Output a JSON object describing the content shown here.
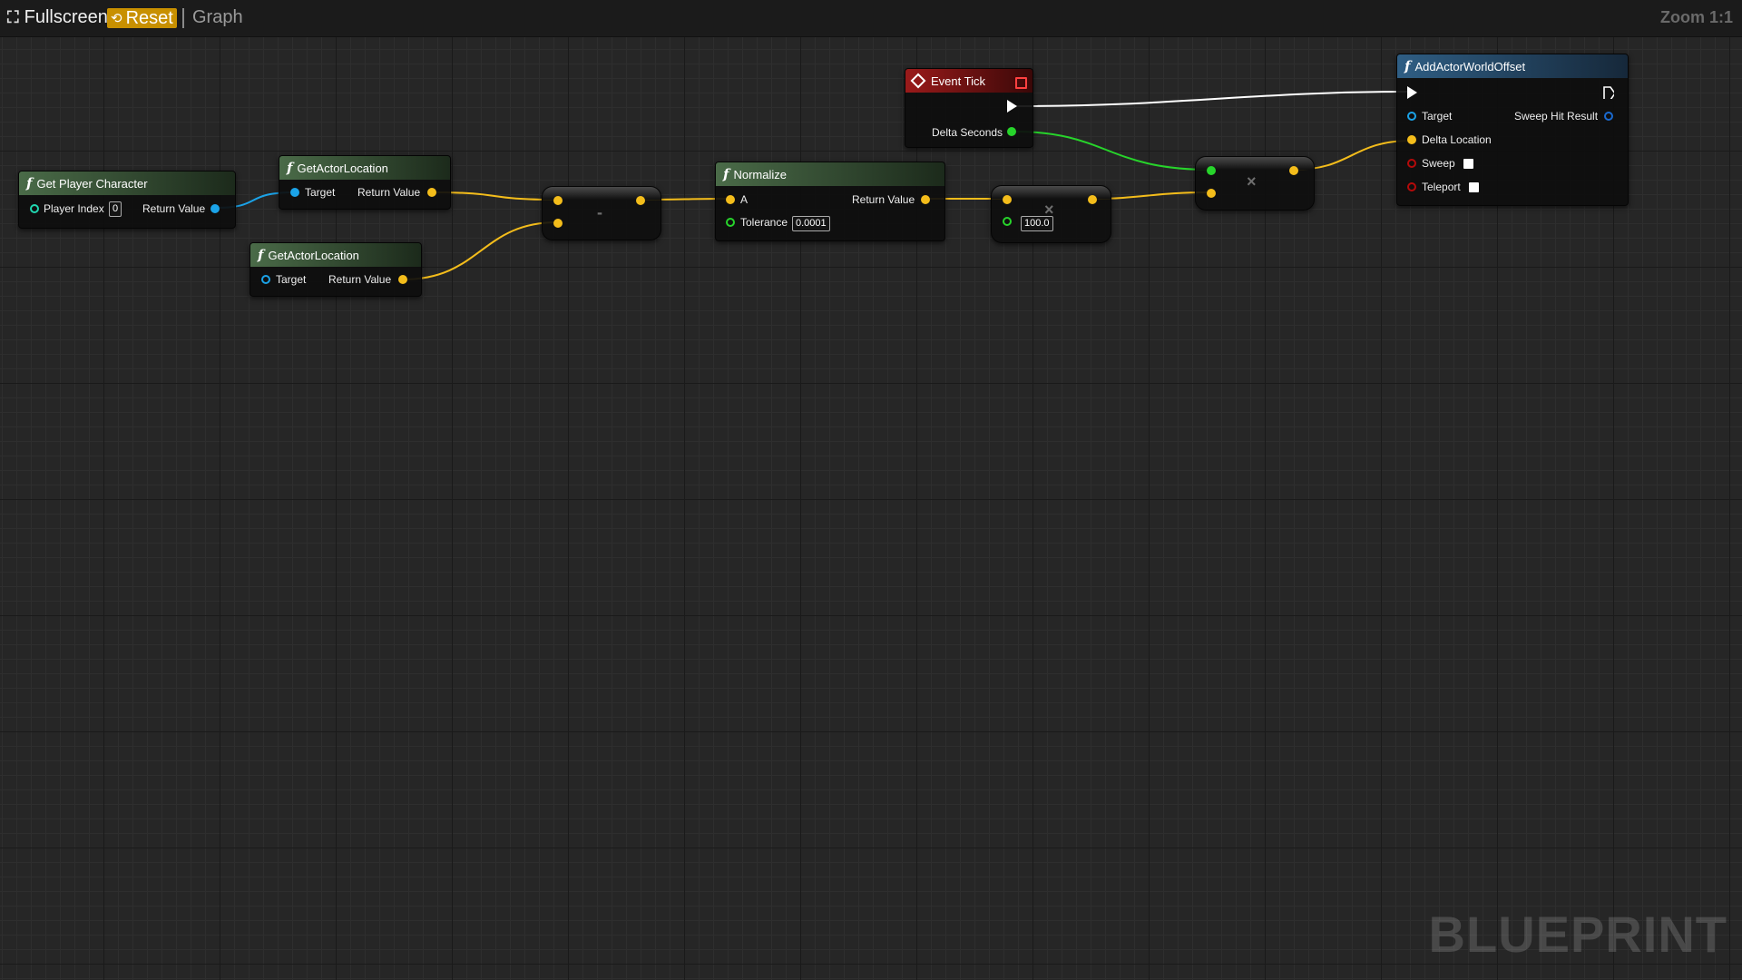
{
  "toolbar": {
    "fullscreen_label": "Fullscreen",
    "reset_label": "Reset",
    "graph_label": "Graph",
    "zoom_label": "Zoom 1:1"
  },
  "watermark": "BLUEPRINT",
  "colors": {
    "vector_pin": "#f4bd1b",
    "object_pin": "#1ba3e8",
    "float_pin": "#27d42b",
    "exec_pin": "#ffffff",
    "bool_pin": "#b50a0a",
    "function_header": "#4a6b48",
    "event_header": "#9a1a1a",
    "target_header": "#2f5e84"
  },
  "nodes": {
    "get_player_character": {
      "title": "Get Player Character",
      "in_pin": "Player Index",
      "in_value": "0",
      "out_pin": "Return Value"
    },
    "get_actor_location_1": {
      "title": "GetActorLocation",
      "in_pin": "Target",
      "out_pin": "Return Value"
    },
    "get_actor_location_2": {
      "title": "GetActorLocation",
      "in_pin": "Target",
      "out_pin": "Return Value"
    },
    "subtract": {
      "symbol": "-"
    },
    "normalize": {
      "title": "Normalize",
      "in_pin_a": "A",
      "in_pin_tol": "Tolerance",
      "tol_value": "0.0001",
      "out_pin": "Return Value"
    },
    "multiply_1": {
      "symbol": "×",
      "b_value": "100.0"
    },
    "event_tick": {
      "title": "Event Tick",
      "out_pin": "Delta Seconds"
    },
    "multiply_2": {
      "symbol": "×"
    },
    "add_actor_world_offset": {
      "title": "AddActorWorldOffset",
      "pin_target": "Target",
      "pin_sweep_hit": "Sweep Hit Result",
      "pin_delta": "Delta Location",
      "pin_sweep": "Sweep",
      "pin_teleport": "Teleport"
    }
  }
}
